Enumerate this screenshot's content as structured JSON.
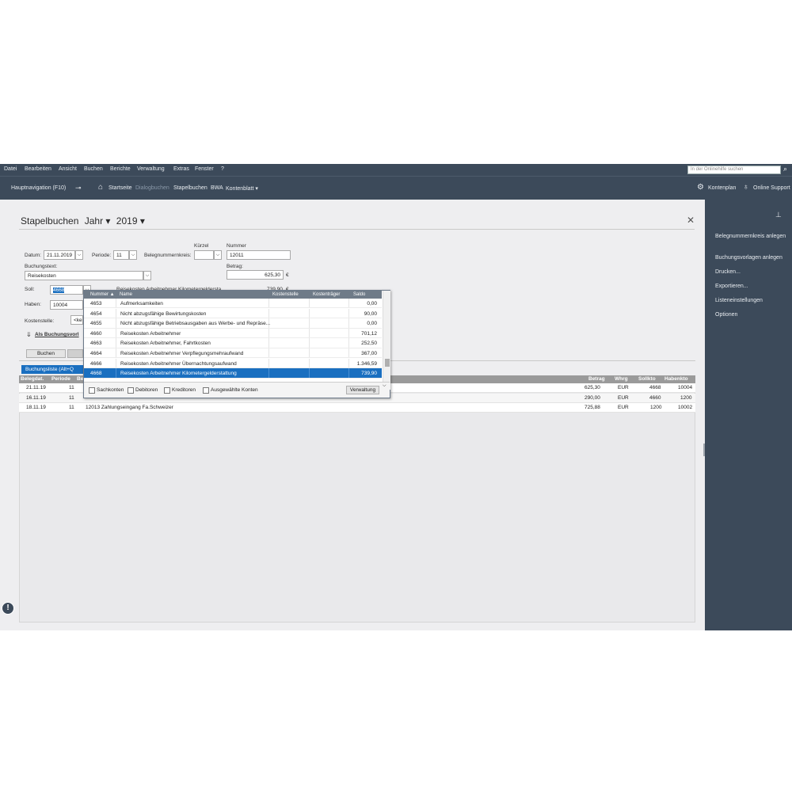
{
  "menubar": {
    "items": [
      "Datei",
      "Bearbeiten",
      "Ansicht",
      "Buchen",
      "Berichte",
      "Verwaltung",
      "Extras",
      "Fenster",
      "?"
    ],
    "search_placeholder": "In der Onlinehilfe suchen"
  },
  "navbar": {
    "hauptnavigation": "Hauptnavigation (F10)",
    "startseite": "Startseite",
    "dialogbuchen": "Dialogbuchen",
    "stapelbuchen": "Stapelbuchen",
    "bwa": "BWA",
    "kontenblatt": "Kontenblatt ▾",
    "kontenplan": "Kontenplan",
    "online_support": "Online Support"
  },
  "sidebar": {
    "items": [
      "Belegnummernkreis anlegen",
      "Buchungsvorlagen anlegen",
      "Drucken...",
      "Exportieren...",
      "Listeneinstellungen",
      "Optionen"
    ]
  },
  "header": {
    "title": "Stapelbuchen",
    "jahr": "Jahr ▾",
    "year": "2019 ▾"
  },
  "form": {
    "datum_label": "Datum:",
    "datum_value": "21.11.2019",
    "periode_label": "Periode:",
    "periode_value": "11",
    "belegnummernkreis_label": "Belegnummernkreis:",
    "kuerzel_label": "Kürzel",
    "nummer_label": "Nummer",
    "nummer_value": "12011",
    "buchungstext_label": "Buchungstext:",
    "buchungstext_value": "Reisekosten",
    "betrag_label": "Betrag:",
    "betrag_value": "625,30",
    "currency": "€",
    "soll_label": "Soll:",
    "soll_value": "4668",
    "soll_desc": "Reisekosten Arbeitnehmer Kilometergeldersta...",
    "soll_amount": "739,90",
    "haben_label": "Haben:",
    "haben_value": "10004",
    "kostenstelle_label": "Kostenstelle:",
    "kostenstelle_value": "<kei",
    "als_buchungsvorlage": "Als Buchungsvorl",
    "buchen_button": "Buchen",
    "buchungsliste_tab": "Buchungsliste (Alt+Q"
  },
  "grid": {
    "columns": [
      "Belegdat.",
      "Periode",
      "Be",
      "Betrag",
      "Whrg",
      "Sollkto",
      "Habenkto"
    ],
    "rows": [
      {
        "date": "21.11.19",
        "periode": "11",
        "text": "",
        "betrag": "625,30",
        "whrg": "EUR",
        "soll": "4668",
        "haben": "10004"
      },
      {
        "date": "16.11.19",
        "periode": "11",
        "text": "",
        "betrag": "290,00",
        "whrg": "EUR",
        "soll": "4660",
        "haben": "1200"
      },
      {
        "date": "18.11.19",
        "periode": "11",
        "text": "12013 Zahlungseingang Fa.Schweizer",
        "betrag": "725,88",
        "whrg": "EUR",
        "soll": "1200",
        "haben": "10002"
      }
    ]
  },
  "popup": {
    "columns": [
      "Nummer ▲",
      "Name",
      "Kostenstelle",
      "Kostenträger",
      "Saldo"
    ],
    "rows": [
      {
        "nummer": "4653",
        "name": "Aufmerksamkeiten",
        "saldo": "0,00"
      },
      {
        "nummer": "4654",
        "name": "Nicht abzugsfähige Bewirtungskosten",
        "saldo": "90,00"
      },
      {
        "nummer": "4655",
        "name": "Nicht abzugsfähige Betriebsausgaben aus Werbe- und Repräse...",
        "saldo": "0,00"
      },
      {
        "nummer": "4660",
        "name": "Reisekosten Arbeitnehmer",
        "saldo": "701,12"
      },
      {
        "nummer": "4663",
        "name": "Reisekosten Arbeitnehmer, Fahrtkosten",
        "saldo": "252,50"
      },
      {
        "nummer": "4664",
        "name": "Reisekosten Arbeitnehmer Verpflegungsmehraufwand",
        "saldo": "367,00"
      },
      {
        "nummer": "4666",
        "name": "Reisekosten Arbeitnehmer Übernachtungsaufwand",
        "saldo": "1.346,59"
      },
      {
        "nummer": "4668",
        "name": "Reisekosten Arbeitnehmer Kilometergelderstattung",
        "saldo": "739,90"
      }
    ],
    "filters": [
      "Sachkonten",
      "Debitoren",
      "Kreditoren",
      "Ausgewählte Konten"
    ],
    "verwaltung_button": "Verwaltung"
  },
  "colors": {
    "nav_bg": "#3c4a5a",
    "accent": "#1a6fc0"
  }
}
